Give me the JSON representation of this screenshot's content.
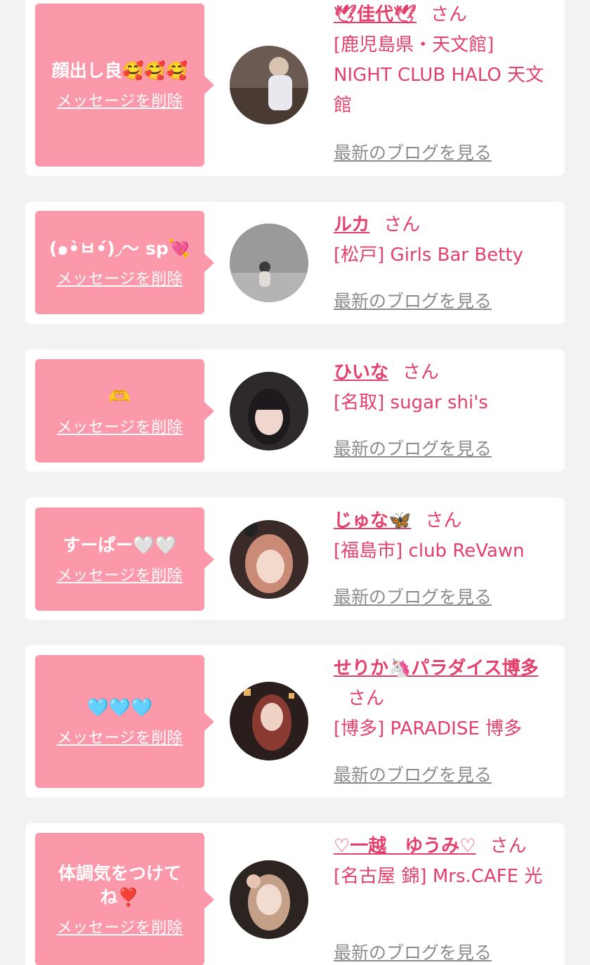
{
  "delete_label": "メッセージを削除",
  "blog_label": "最新のブログを見る",
  "honorific": "さん",
  "cards": [
    {
      "message": "顔出し良🥰🥰🥰",
      "name": "🕊佳代🕊",
      "shop": "[鹿児島県・天文館] NIGHT CLUB HALO 天文館"
    },
    {
      "message": "(๑•̀ㅂ•́)◞〜 sp💘",
      "name": "ルカ",
      "shop": "[松戸] Girls Bar Betty"
    },
    {
      "message": "🫶",
      "name": "ひいな",
      "shop": "[名取] sugar shi's"
    },
    {
      "message": "すーぱー🤍🤍",
      "name": "じゅな🦋",
      "shop": "[福島市] club ReVawn"
    },
    {
      "message": "🩵🩵🩵",
      "name": "せりか🦄パラダイス博多",
      "shop": "[博多] PARADISE 博多"
    },
    {
      "message": "体調気をつけてね❣️",
      "name": "♡一越　ゆうみ♡",
      "shop": "[名古屋 錦] Mrs.CAFE 光"
    }
  ],
  "colors": {
    "bubble": "#fb98aa",
    "accent": "#e4406c",
    "muted": "#8c8c8c",
    "background": "#f2f2f2"
  }
}
